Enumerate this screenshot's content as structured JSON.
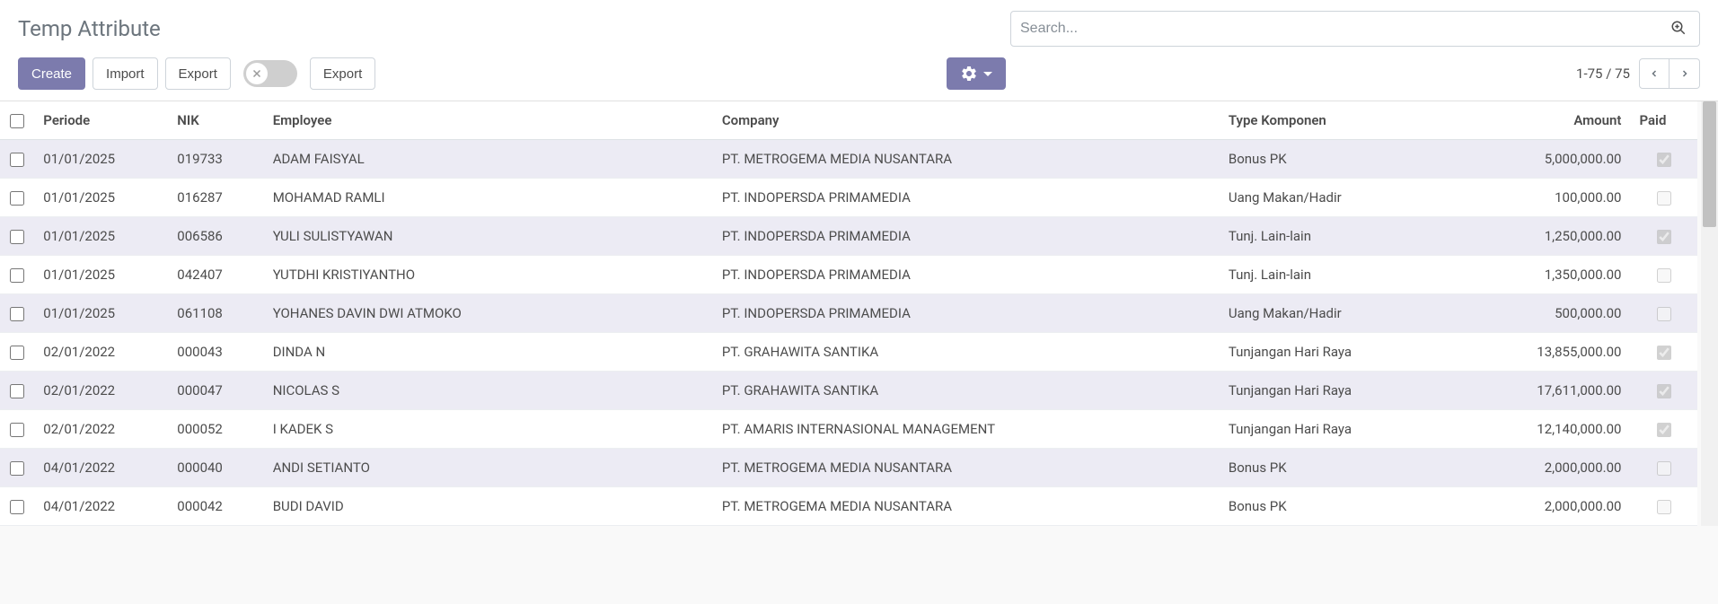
{
  "breadcrumb": "Temp Attribute",
  "search": {
    "placeholder": "Search..."
  },
  "buttons": {
    "create": "Create",
    "import": "Import",
    "export1": "Export",
    "export2": "Export"
  },
  "pager": {
    "range": "1-75",
    "sep": " / ",
    "total": "75"
  },
  "columns": {
    "periode": "Periode",
    "nik": "NIK",
    "employee": "Employee",
    "company": "Company",
    "type": "Type Komponen",
    "amount": "Amount",
    "paid": "Paid"
  },
  "rows": [
    {
      "periode": "01/01/2025",
      "nik": "019733",
      "employee": "ADAM FAISYAL",
      "company": "PT. METROGEMA MEDIA NUSANTARA",
      "type": "Bonus PK",
      "amount": "5,000,000.00",
      "paid": true
    },
    {
      "periode": "01/01/2025",
      "nik": "016287",
      "employee": "MOHAMAD RAMLI",
      "company": "PT. INDOPERSDA PRIMAMEDIA",
      "type": "Uang Makan/Hadir",
      "amount": "100,000.00",
      "paid": false
    },
    {
      "periode": "01/01/2025",
      "nik": "006586",
      "employee": "YULI SULISTYAWAN",
      "company": "PT. INDOPERSDA PRIMAMEDIA",
      "type": "Tunj. Lain-lain",
      "amount": "1,250,000.00",
      "paid": true
    },
    {
      "periode": "01/01/2025",
      "nik": "042407",
      "employee": "YUTDHI KRISTIYANTHO",
      "company": "PT. INDOPERSDA PRIMAMEDIA",
      "type": "Tunj. Lain-lain",
      "amount": "1,350,000.00",
      "paid": false
    },
    {
      "periode": "01/01/2025",
      "nik": "061108",
      "employee": "YOHANES DAVIN DWI ATMOKO",
      "company": "PT. INDOPERSDA PRIMAMEDIA",
      "type": "Uang Makan/Hadir",
      "amount": "500,000.00",
      "paid": false
    },
    {
      "periode": "02/01/2022",
      "nik": "000043",
      "employee": "DINDA N",
      "company": "PT. GRAHAWITA SANTIKA",
      "type": "Tunjangan Hari Raya",
      "amount": "13,855,000.00",
      "paid": true
    },
    {
      "periode": "02/01/2022",
      "nik": "000047",
      "employee": "NICOLAS S",
      "company": "PT. GRAHAWITA SANTIKA",
      "type": "Tunjangan Hari Raya",
      "amount": "17,611,000.00",
      "paid": true
    },
    {
      "periode": "02/01/2022",
      "nik": "000052",
      "employee": "I KADEK S",
      "company": "PT. AMARIS INTERNASIONAL MANAGEMENT",
      "type": "Tunjangan Hari Raya",
      "amount": "12,140,000.00",
      "paid": true
    },
    {
      "periode": "04/01/2022",
      "nik": "000040",
      "employee": "ANDI SETIANTO",
      "company": "PT. METROGEMA MEDIA NUSANTARA",
      "type": "Bonus PK",
      "amount": "2,000,000.00",
      "paid": false
    },
    {
      "periode": "04/01/2022",
      "nik": "000042",
      "employee": "BUDI DAVID",
      "company": "PT. METROGEMA MEDIA NUSANTARA",
      "type": "Bonus PK",
      "amount": "2,000,000.00",
      "paid": false
    }
  ]
}
